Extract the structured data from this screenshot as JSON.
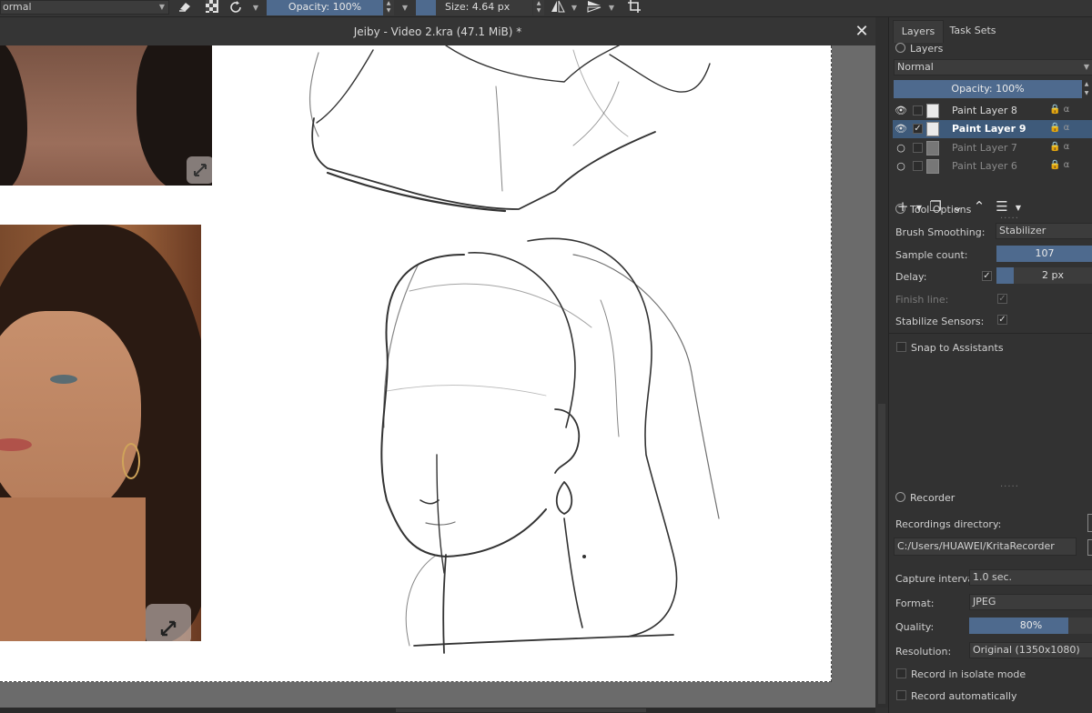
{
  "toolbar": {
    "blend_mode": "ormal",
    "opacity_label": "Opacity: 100%",
    "size_label": "Size: 4.64 px",
    "icons": [
      "eraser-icon",
      "alpha-icon",
      "reload-icon",
      "mirror-horizontal-icon",
      "mirror-vertical-icon",
      "crop-icon"
    ]
  },
  "document": {
    "title": "Jeiby - Video 2.kra (47.1 MiB) *",
    "close_glyph": "✕"
  },
  "docker": {
    "tabs": [
      "Layers",
      "Task Sets"
    ],
    "layers": {
      "title": "Layers",
      "blend_mode": "Normal",
      "opacity": "Opacity:  100%",
      "items": [
        {
          "name": "Paint Layer 8",
          "visible": true,
          "checked": false,
          "selected": false,
          "dim": false
        },
        {
          "name": "Paint Layer 9",
          "visible": true,
          "checked": true,
          "selected": true,
          "dim": false
        },
        {
          "name": "Paint Layer 7",
          "visible": false,
          "checked": false,
          "selected": false,
          "dim": true
        },
        {
          "name": "Paint Layer 6",
          "visible": false,
          "checked": false,
          "selected": false,
          "dim": true
        }
      ]
    },
    "tool_options": {
      "title": "Tool Options",
      "brush_smoothing_label": "Brush Smoothing:",
      "brush_smoothing_value": "Stabilizer",
      "sample_count_label": "Sample count:",
      "sample_count_value": "107",
      "delay_label": "Delay:",
      "delay_value": "2 px",
      "finish_line_label": "Finish line:",
      "stabilize_sensors_label": "Stabilize Sensors:",
      "snap_label": "Snap to Assistants"
    },
    "recorder": {
      "title": "Recorder",
      "dir_label": "Recordings directory:",
      "dir_value": "C:/Users/HUAWEI/KritaRecorder",
      "interval_label": "Capture interval:",
      "interval_value": "1.0 sec.",
      "format_label": "Format:",
      "format_value": "JPEG",
      "quality_label": "Quality:",
      "quality_value": "80%",
      "quality_fraction": 0.8,
      "resolution_label": "Resolution:",
      "resolution_value": "Original (1350x1080)",
      "isolate_label": "Record in isolate mode",
      "auto_label": "Record automatically"
    }
  }
}
